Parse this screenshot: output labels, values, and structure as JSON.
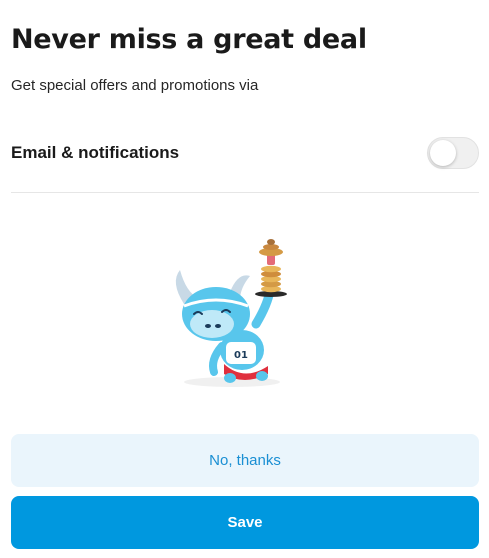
{
  "header": {
    "title": "Never miss a great deal",
    "subtitle": "Get special offers and promotions via"
  },
  "preference": {
    "label": "Email & notifications",
    "enabled": false
  },
  "illustration": {
    "icon": "mascot-illustration",
    "jersey_number": "01"
  },
  "actions": {
    "decline_label": "No, thanks",
    "save_label": "Save"
  },
  "colors": {
    "primary": "#0098df",
    "secondary_bg": "#eaf5fc",
    "secondary_text": "#1a8fd3"
  }
}
